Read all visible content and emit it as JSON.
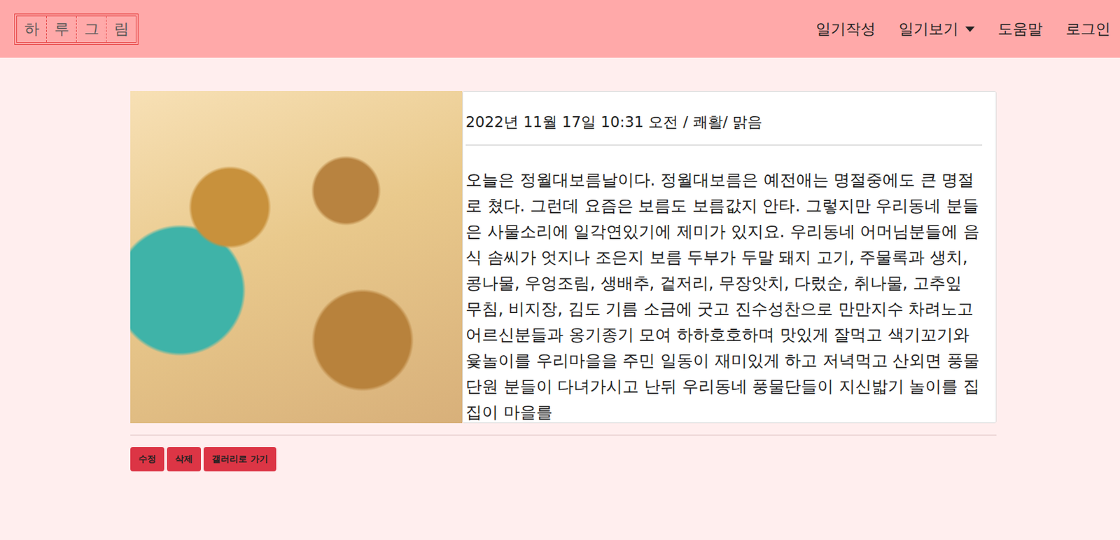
{
  "header": {
    "logo": "하루그림",
    "nav": [
      {
        "label": "일기작성",
        "dropdown": false
      },
      {
        "label": "일기보기",
        "dropdown": true
      },
      {
        "label": "도움말",
        "dropdown": false
      },
      {
        "label": "로그인",
        "dropdown": false
      }
    ]
  },
  "diary": {
    "meta": "2022년 11월 17일 10:31 오전 / 쾌활/ 맑음",
    "body": "오늘은 정월대보름날이다. 정월대보름은 예전애는 명절중에도 큰 명절로 쳤다. 그런데 요즘은 보름도 보름값지 안타. 그렇지만 우리동네 분들은 사물소리에 일각연있기에 제미가 있지요. 우리동네 어머님분들에 음식 솜씨가 엇지나 조은지 보름 두부가 두말 돼지 고기, 주물록과 생치, 콩나물, 우엉조림, 생배추, 겉저리, 무장앗치, 다렀순, 취나물, 고추잎 무침, 비지장, 김도 기름 소금에 굿고 진수성찬으로 만만지수 차려노고 어르신분들과 옹기종기 모여 하하호호하며 맛있게 잘먹고 색기꼬기와 윷놀이를 우리마을을 주민 일동이 재미있게 하고 저녁먹고 산외면 풍물 단원 분들이 다녀가시고 난뒤 우리동네 풍물단들이 지신밟기 놀이를 집집이 마을를"
  },
  "buttons": [
    "수정",
    "삭제",
    "갤러리로 가기"
  ]
}
